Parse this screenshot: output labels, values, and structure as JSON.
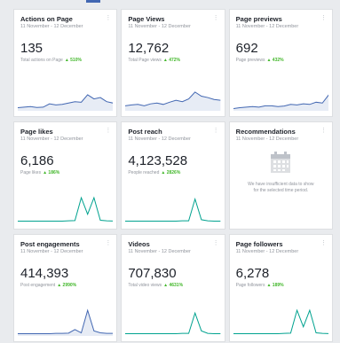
{
  "cards": [
    {
      "title": "Actions on Page",
      "date": "11 November - 12 December",
      "value": "135",
      "sub_text": "Total actions on Page",
      "sub_pct": "▲ 510%",
      "spark_color": "#4267b2",
      "spark_fill": "#e7ecf5",
      "spark_points": [
        0.08,
        0.1,
        0.12,
        0.09,
        0.1,
        0.22,
        0.18,
        0.2,
        0.25,
        0.3,
        0.28,
        0.55,
        0.4,
        0.45,
        0.3,
        0.25
      ]
    },
    {
      "title": "Page Views",
      "date": "11 November - 12 December",
      "value": "12,762",
      "sub_text": "Total Page views",
      "sub_pct": "▲ 472%",
      "spark_color": "#4267b2",
      "spark_fill": "#e7ecf5",
      "spark_points": [
        0.15,
        0.18,
        0.2,
        0.15,
        0.22,
        0.25,
        0.2,
        0.28,
        0.35,
        0.3,
        0.4,
        0.65,
        0.5,
        0.45,
        0.38,
        0.35
      ]
    },
    {
      "title": "Page previews",
      "date": "11 November - 12 December",
      "value": "692",
      "sub_text": "Page previews",
      "sub_pct": "▲ 432%",
      "spark_color": "#4267b2",
      "spark_fill": "#e7ecf5",
      "spark_points": [
        0.05,
        0.08,
        0.1,
        0.12,
        0.1,
        0.15,
        0.15,
        0.12,
        0.14,
        0.2,
        0.18,
        0.22,
        0.2,
        0.28,
        0.25,
        0.55
      ]
    },
    {
      "title": "Page likes",
      "date": "11 November - 12 December",
      "value": "6,186",
      "sub_text": "Page likes",
      "sub_pct": "▲ 186%",
      "spark_color": "#00a28f",
      "spark_fill": "none",
      "spark_points": [
        0.05,
        0.05,
        0.05,
        0.05,
        0.05,
        0.05,
        0.05,
        0.05,
        0.06,
        0.07,
        0.9,
        0.3,
        0.9,
        0.08,
        0.06,
        0.05
      ]
    },
    {
      "title": "Post reach",
      "date": "11 November - 12 December",
      "value": "4,123,528",
      "sub_text": "People reached",
      "sub_pct": "▲ 2826%",
      "spark_color": "#00a28f",
      "spark_fill": "none",
      "spark_points": [
        0.05,
        0.05,
        0.05,
        0.05,
        0.05,
        0.05,
        0.05,
        0.05,
        0.05,
        0.06,
        0.06,
        0.85,
        0.1,
        0.06,
        0.05,
        0.05
      ]
    },
    {
      "title": "Recommendations",
      "date": "11 November - 12 December",
      "empty_text": "We have insufficient data to show for the selected time period."
    },
    {
      "title": "Post engagements",
      "date": "11 November - 12 December",
      "value": "414,393",
      "sub_text": "Post engagement",
      "sub_pct": "▲ 2990%",
      "spark_color": "#4267b2",
      "spark_fill": "#e7ecf5",
      "spark_points": [
        0.05,
        0.05,
        0.05,
        0.05,
        0.05,
        0.05,
        0.06,
        0.06,
        0.07,
        0.2,
        0.08,
        0.9,
        0.15,
        0.08,
        0.06,
        0.06
      ]
    },
    {
      "title": "Videos",
      "date": "11 November - 12 December",
      "value": "707,830",
      "sub_text": "Total video views",
      "sub_pct": "▲ 4631%",
      "spark_color": "#00a28f",
      "spark_fill": "none",
      "spark_points": [
        0.05,
        0.05,
        0.05,
        0.05,
        0.05,
        0.05,
        0.05,
        0.05,
        0.05,
        0.06,
        0.06,
        0.8,
        0.15,
        0.06,
        0.05,
        0.05
      ]
    },
    {
      "title": "Page followers",
      "date": "11 November - 12 December",
      "value": "6,278",
      "sub_text": "Page followers",
      "sub_pct": "▲ 189%",
      "spark_color": "#00a28f",
      "spark_fill": "none",
      "spark_points": [
        0.05,
        0.05,
        0.05,
        0.05,
        0.05,
        0.05,
        0.05,
        0.05,
        0.06,
        0.07,
        0.9,
        0.3,
        0.9,
        0.08,
        0.06,
        0.05
      ]
    }
  ]
}
